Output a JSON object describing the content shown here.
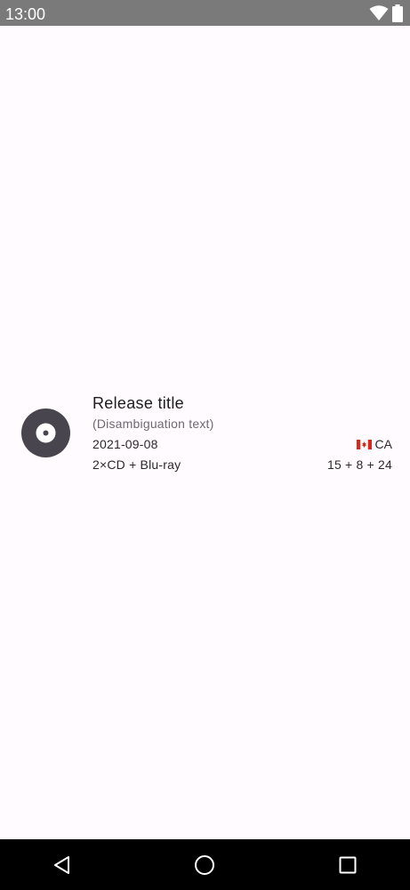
{
  "status_bar": {
    "time": "13:00",
    "icons": [
      "wifi-icon",
      "battery-icon"
    ],
    "background": "#7a7a7a"
  },
  "release": {
    "title": "Release title",
    "disambiguation": "(Disambiguation text)",
    "date": "2021-09-08",
    "country_code": "CA",
    "country_flag": "canada-flag-icon",
    "formats": "2×CD + Blu-ray",
    "tracks": "15 + 8 + 24",
    "icon": "disc-icon",
    "icon_color": "#49454f"
  },
  "nav_bar": {
    "buttons": [
      "back-icon",
      "home-icon",
      "recents-icon"
    ]
  },
  "colors": {
    "background": "#fffbfe",
    "primary_text": "#1c1b1f",
    "secondary_text": "#6e6a72"
  }
}
